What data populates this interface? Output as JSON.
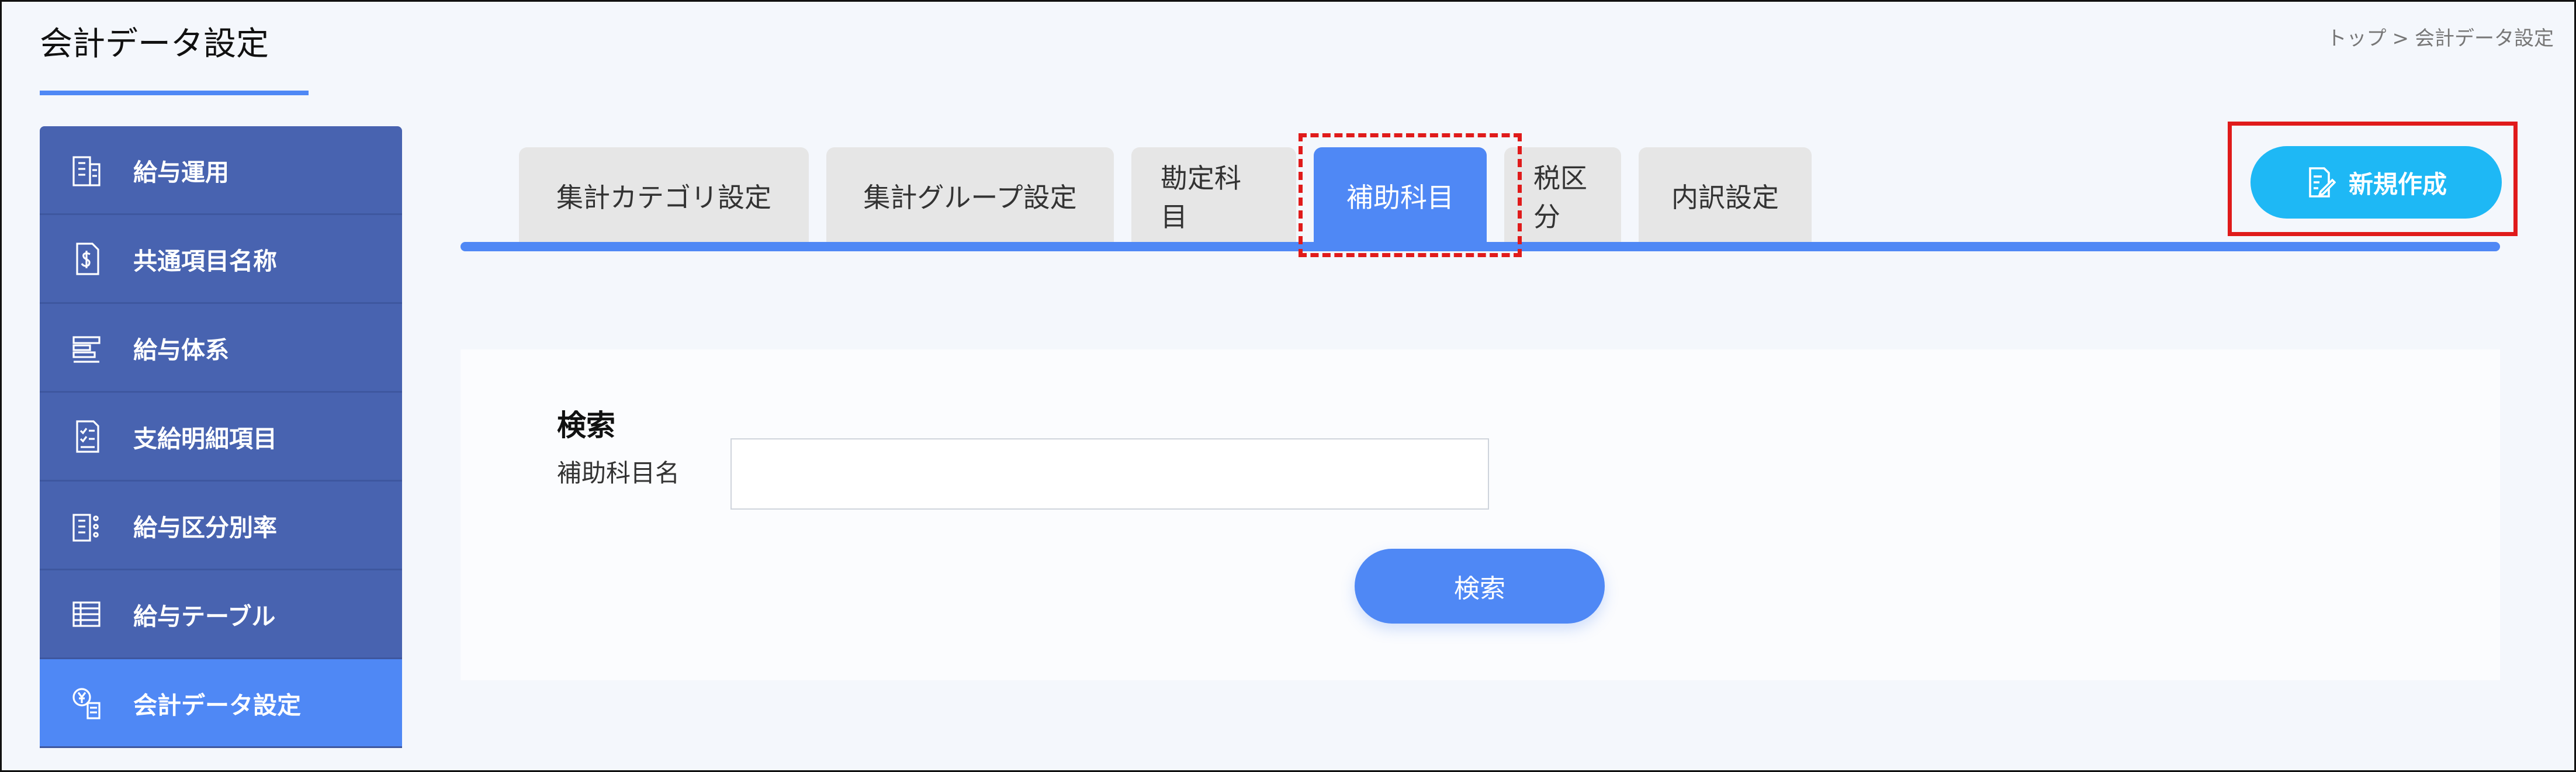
{
  "header": {
    "title": "会計データ設定"
  },
  "breadcrumb": {
    "home": "トップ",
    "separator": ">",
    "current": "会計データ設定"
  },
  "sidebar": {
    "items": [
      {
        "label": "給与運用",
        "icon": "building-icon",
        "active": false
      },
      {
        "label": "共通項目名称",
        "icon": "dollar-document-icon",
        "active": false
      },
      {
        "label": "給与体系",
        "icon": "structure-icon",
        "active": false
      },
      {
        "label": "支給明細項目",
        "icon": "checklist-document-icon",
        "active": false
      },
      {
        "label": "給与区分別率",
        "icon": "building-list-icon",
        "active": false
      },
      {
        "label": "給与テーブル",
        "icon": "table-icon",
        "active": false
      },
      {
        "label": "会計データ設定",
        "icon": "yen-coins-document-icon",
        "active": true
      }
    ]
  },
  "tabs": [
    {
      "label": "集計カテゴリ設定",
      "active": false
    },
    {
      "label": "集計グループ設定",
      "active": false
    },
    {
      "label": "勘定科目",
      "active": false
    },
    {
      "label": "補助科目",
      "active": true
    },
    {
      "label": "税区分",
      "active": false
    },
    {
      "label": "内訳設定",
      "active": false
    }
  ],
  "new_button": {
    "label": "新規作成",
    "icon": "edit-document-icon"
  },
  "search": {
    "heading": "検索",
    "field_label": "補助科目名",
    "field_value": "",
    "button_label": "検索"
  },
  "colors": {
    "accent": "#4f88f5",
    "sidebar": "#4863b0",
    "new_button": "#1eb8f5",
    "highlight": "#e01b1b"
  }
}
